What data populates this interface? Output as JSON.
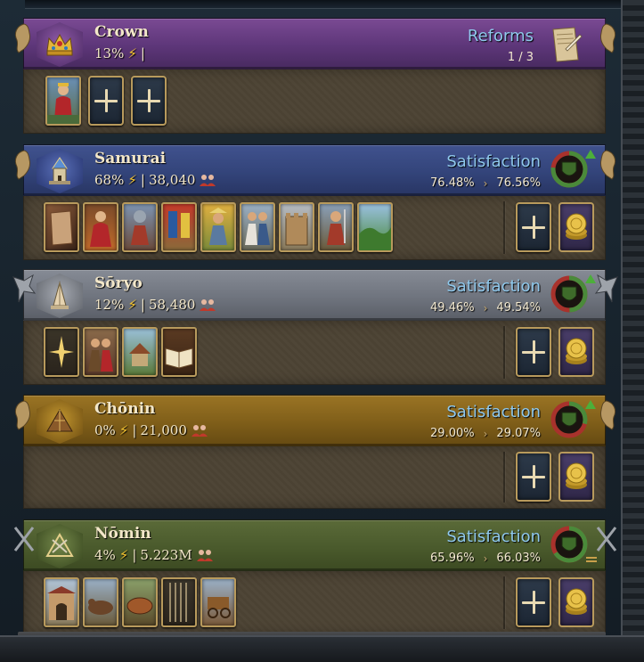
{
  "estates": [
    {
      "key": "crown",
      "name": "Crown",
      "power": "13%",
      "population": "",
      "reforms_label": "Reforms",
      "reforms_count": "1 / 3",
      "emblem_icon": "crown-icon"
    },
    {
      "key": "samurai",
      "name": "Samurai",
      "power": "68%",
      "population": "38,040",
      "satisfaction_label": "Satisfaction",
      "satisfaction_from": "76.48%",
      "satisfaction_to": "76.56%",
      "satisfaction_fraction": 0.7656,
      "trend": "up",
      "emblem_icon": "castle-tower-icon",
      "privileges": [
        "scroll",
        "court",
        "knight",
        "banners",
        "farmer",
        "couple",
        "fortress",
        "soldier",
        "landscape"
      ]
    },
    {
      "key": "soryo",
      "name": "Sōryo",
      "power": "12%",
      "population": "58,480",
      "satisfaction_label": "Satisfaction",
      "satisfaction_from": "49.46%",
      "satisfaction_to": "49.54%",
      "satisfaction_fraction": 0.4954,
      "trend": "up",
      "emblem_icon": "praying-hands-icon",
      "privileges": [
        "star",
        "monks",
        "monastery",
        "holy-book"
      ]
    },
    {
      "key": "chonin",
      "name": "Chōnin",
      "power": "0%",
      "population": "21,000",
      "satisfaction_label": "Satisfaction",
      "satisfaction_from": "29.00%",
      "satisfaction_to": "29.07%",
      "satisfaction_fraction": 0.2907,
      "trend": "up",
      "emblem_icon": "merchant-tent-icon",
      "privileges": []
    },
    {
      "key": "nomin",
      "name": "Nōmin",
      "power": "4%",
      "population": "5.223M",
      "satisfaction_label": "Satisfaction",
      "satisfaction_from": "65.96%",
      "satisfaction_to": "66.03%",
      "satisfaction_fraction": 0.6603,
      "trend": "stable",
      "emblem_icon": "crossed-tools-icon",
      "privileges": [
        "town-gate",
        "oxen",
        "tortoise",
        "spears",
        "cart"
      ]
    }
  ],
  "colors": {
    "satisfaction_text": "#8fc8ec",
    "power_bolt": "#f4c430",
    "ring_positive": "#4a8a3a",
    "ring_negative": "#a8322c"
  }
}
